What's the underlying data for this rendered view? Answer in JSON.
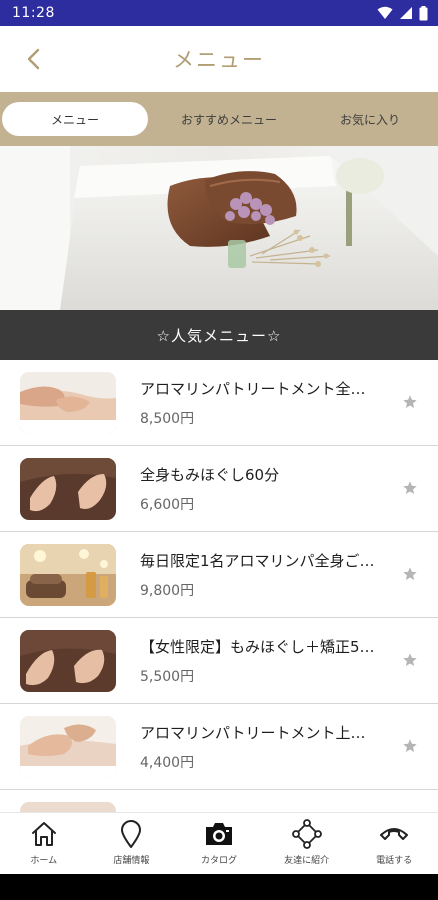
{
  "status_bar": {
    "time": "11:28"
  },
  "header": {
    "title": "メニュー"
  },
  "tabs": [
    {
      "label": "メニュー",
      "active": true
    },
    {
      "label": "おすすめメニュー",
      "active": false
    },
    {
      "label": "お気に入り",
      "active": false
    }
  ],
  "section": {
    "title": "☆人気メニュー☆"
  },
  "menu_items": [
    {
      "name": "アロマリンパトリートメント全…",
      "price": "8,500円"
    },
    {
      "name": "全身もみほぐし60分",
      "price": "6,600円"
    },
    {
      "name": "毎日限定1名アロマリンパ全身ご…",
      "price": "9,800円"
    },
    {
      "name": "【女性限定】もみほぐし＋矯正5…",
      "price": "5,500円"
    },
    {
      "name": "アロマリンパトリートメント上…",
      "price": "4,400円"
    }
  ],
  "bottom_nav": [
    {
      "label": "ホーム",
      "icon": "home-icon"
    },
    {
      "label": "店舗情報",
      "icon": "map-pin-icon"
    },
    {
      "label": "カタログ",
      "icon": "camera-icon"
    },
    {
      "label": "友達に紹介",
      "icon": "share-icon"
    },
    {
      "label": "電話する",
      "icon": "phone-icon"
    }
  ],
  "colors": {
    "status_bar": "#2d2da0",
    "accent": "#b19e75",
    "tab_bar": "#c2b291",
    "section_bar": "#3a3a3a",
    "star": "#b5b5b5"
  }
}
